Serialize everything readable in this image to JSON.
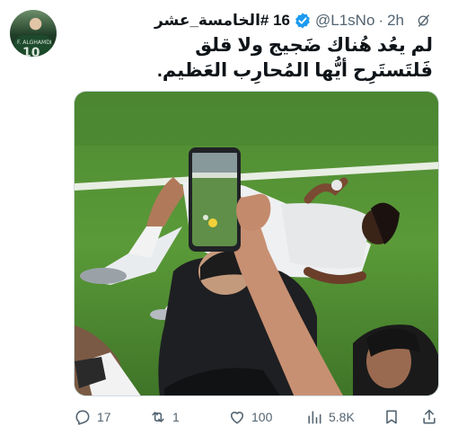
{
  "post": {
    "display_name": "16 #الخامسة_عشر",
    "handle": "@L1sNo",
    "separator": "·",
    "timestamp": "2h",
    "text_line1": "لم يعُد هُناك ضَجيج ولا قلق",
    "text_line2": "فَلتَستَرِح أيُّها المُحارِب العَظيم.",
    "avatar_text": "F. ALGHAMDI",
    "avatar_number": "10"
  },
  "actions": {
    "replies": "17",
    "retweets": "1",
    "likes": "100",
    "views": "5.8K"
  },
  "icons": {
    "grok": "grok-icon",
    "verified": "verified-badge-icon",
    "reply": "reply-icon",
    "retweet": "retweet-icon",
    "like": "heart-icon",
    "views": "views-icon",
    "bookmark": "bookmark-icon",
    "share": "share-icon"
  },
  "colors": {
    "verified": "#1d9bf0",
    "text_primary": "#0f1419",
    "text_secondary": "#536471"
  }
}
